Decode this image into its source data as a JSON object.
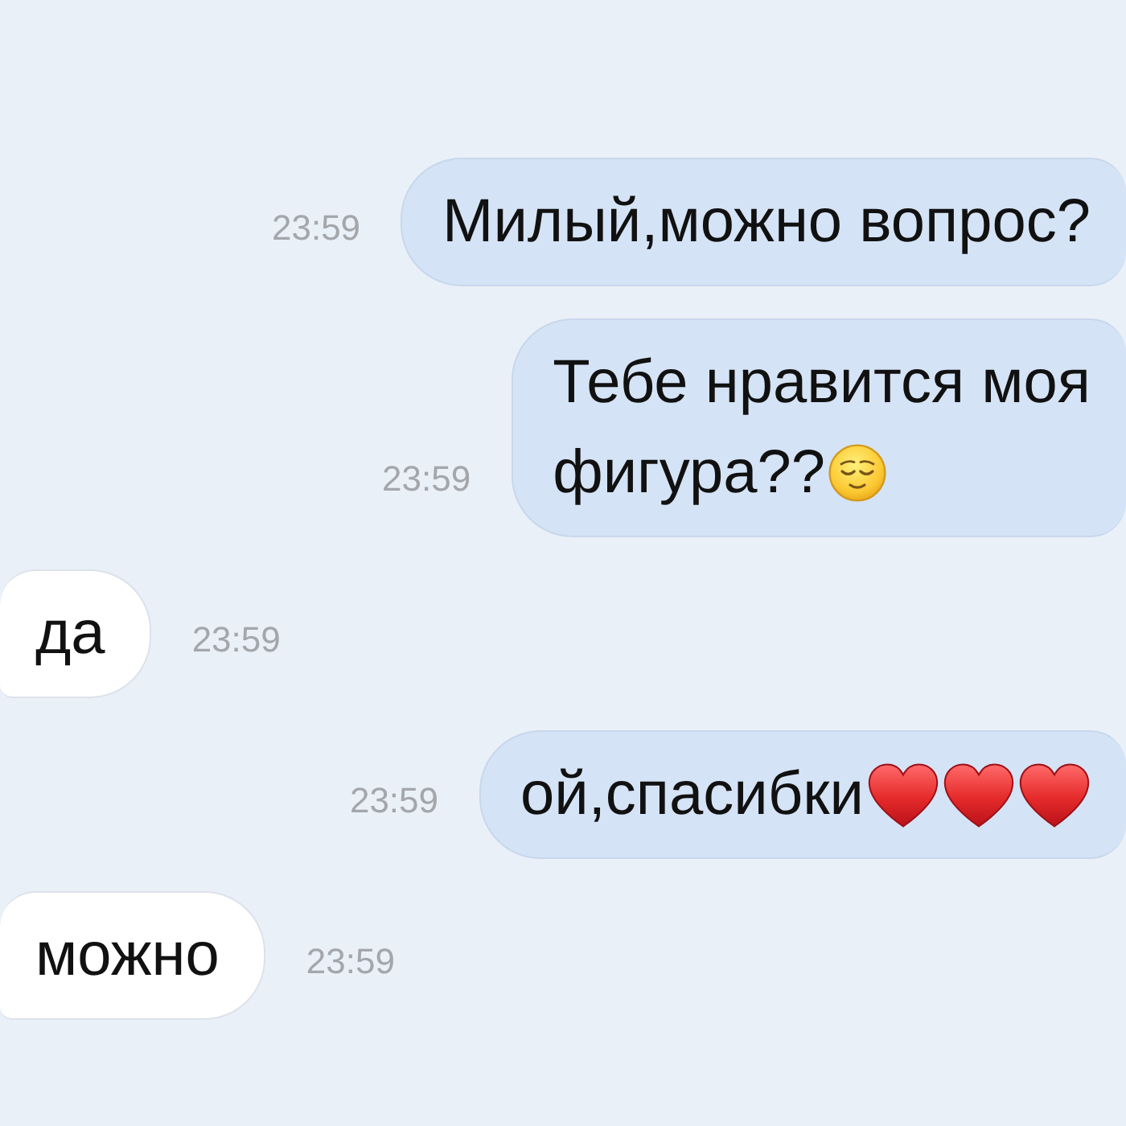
{
  "messages": [
    {
      "kind": "outgoing",
      "time": "23:59",
      "lines": [
        "Милый,можно вопрос?"
      ]
    },
    {
      "kind": "outgoing",
      "time": "23:59",
      "lines": [
        "Тебе нравится моя",
        "фигура??"
      ],
      "emoji": [
        {
          "kind": "relieved_face"
        }
      ]
    },
    {
      "kind": "incoming",
      "lines": [
        "да"
      ],
      "time": "23:59"
    },
    {
      "kind": "outgoing",
      "time": "23:59",
      "lines": [
        "ой,спасибки"
      ],
      "emoji": [
        {
          "kind": "heart"
        },
        {
          "kind": "heart"
        },
        {
          "kind": "heart"
        }
      ]
    },
    {
      "kind": "incoming",
      "lines": [
        "можно"
      ],
      "time": "23:59"
    }
  ]
}
